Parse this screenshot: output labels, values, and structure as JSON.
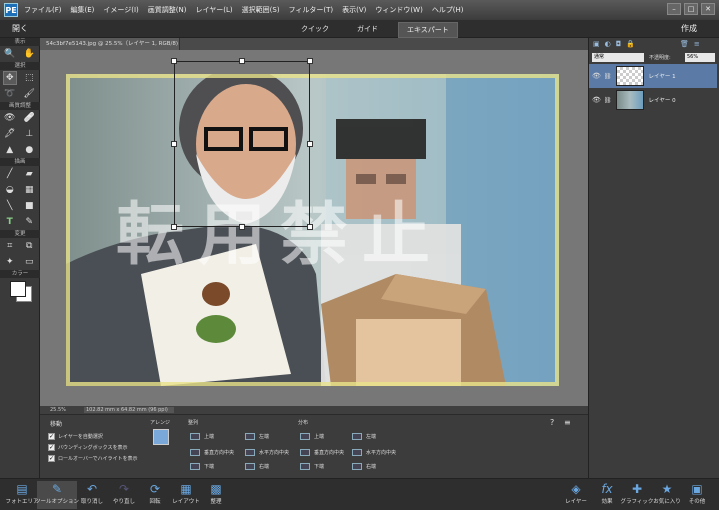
{
  "menubar": {
    "logo": "PE",
    "items": [
      "ファイル(F)",
      "編集(E)",
      "イメージ(I)",
      "画質調整(N)",
      "レイヤー(L)",
      "選択範囲(S)",
      "フィルター(T)",
      "表示(V)",
      "ウィンドウ(W)",
      "ヘルプ(H)"
    ],
    "window_buttons": [
      "–",
      "□",
      "✕"
    ]
  },
  "modebar": {
    "open_label": "開く",
    "tabs": [
      "クイック",
      "ガイド",
      "エキスパート"
    ],
    "active_tab": "エキスパート",
    "create_label": "作成"
  },
  "toolbox": {
    "sections": [
      "表示",
      "選択",
      "画質調整",
      "描画",
      "変更",
      "カラー"
    ]
  },
  "document": {
    "tab_title": "54c3bf7e5143.jpg @ 25.5%（レイヤー 1, RGB/8) *",
    "watermark": "転用禁止",
    "status_zoom": "25.5%",
    "status_size": "102.82 mm x 64.82 mm (96 ppi)"
  },
  "options": {
    "move_label": "移動",
    "checkboxes": [
      "レイヤーを自動選択",
      "バウンディングボックスを表示",
      "ロールオーバーでハイライトを表示"
    ],
    "arrange_label": "アレンジ",
    "align_label": "整列",
    "align_items": [
      "上端",
      "左端",
      "垂直方向中央",
      "水平方向中央",
      "下端",
      "右端"
    ],
    "distribute_label": "分布",
    "distribute_items": [
      "上端",
      "左端",
      "垂直方向中央",
      "水平方向中央",
      "下端",
      "右端"
    ]
  },
  "layers": {
    "blend_mode": "通常",
    "opacity_label": "不透明度:",
    "opacity_value": "56%",
    "items": [
      {
        "name": "レイヤー 1",
        "selected": true
      },
      {
        "name": "レイヤー 0",
        "selected": false
      }
    ]
  },
  "bottombar": {
    "left_buttons": [
      "フォトエリア",
      "ツールオプション",
      "取り消し",
      "やり直し",
      "回転",
      "レイアウト",
      "整理"
    ],
    "right_buttons": [
      "レイヤー",
      "効果",
      "グラフィック",
      "お気に入り",
      "その他"
    ]
  },
  "colors": {
    "accent_blue": "#5b7ba6",
    "panel_bg": "#3c3c3c",
    "canvas_bg": "#777777"
  }
}
